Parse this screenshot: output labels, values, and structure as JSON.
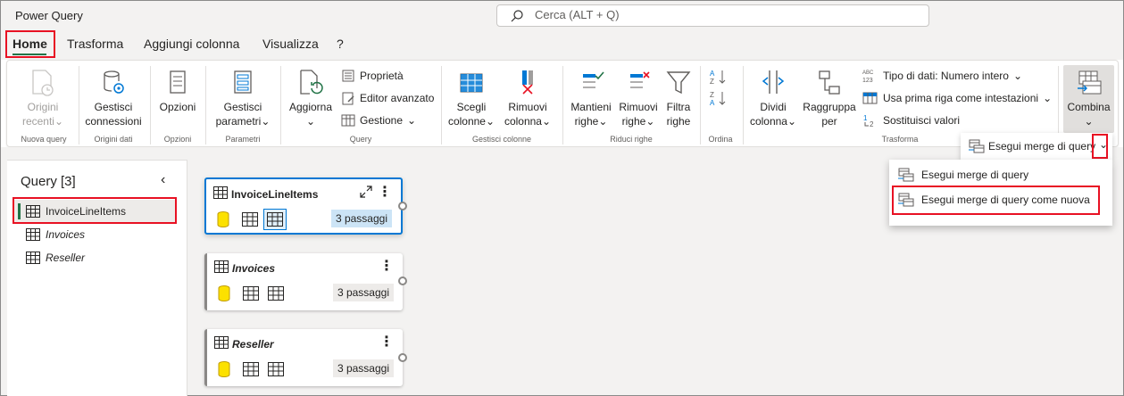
{
  "app": {
    "title": "Power Query"
  },
  "search": {
    "placeholder": "Cerca (ALT + Q)"
  },
  "tabs": [
    {
      "label": "Home",
      "active": true
    },
    {
      "label": "Trasforma"
    },
    {
      "label": "Aggiungi colonna"
    },
    {
      "label": "Visualizza"
    },
    {
      "label": "?"
    }
  ],
  "ribbon": {
    "groups": {
      "nuova_query": "Nuova query",
      "origini_dati": "Origini dati",
      "opzioni": "Opzioni",
      "parametri": "Parametri",
      "query": "Query",
      "gestisci_colonne": "Gestisci colonne",
      "riduci_righe": "Riduci righe",
      "ordina": "Ordina",
      "trasforma": "Trasforma"
    },
    "buttons": {
      "origini_recenti": [
        "Origini",
        "recenti"
      ],
      "gestisci_connessioni": [
        "Gestisci",
        "connessioni"
      ],
      "opzioni": "Opzioni",
      "gestisci_parametri": [
        "Gestisci",
        "parametri"
      ],
      "aggiorna": "Aggiorna",
      "proprieta": "Proprietà",
      "editor_avanzato": "Editor avanzato",
      "gestione": "Gestione",
      "scegli_colonne": [
        "Scegli",
        "colonne"
      ],
      "rimuovi_colonne": [
        "Rimuovi",
        "colonna"
      ],
      "mantieni_righe": [
        "Mantieni",
        "righe"
      ],
      "rimuovi_righe": [
        "Rimuovi",
        "righe"
      ],
      "filtra_righe": [
        "Filtra",
        "righe"
      ],
      "dividi_colonna": [
        "Dividi",
        "colonna"
      ],
      "raggruppa_per": [
        "Raggruppa",
        "per"
      ],
      "tipo_dati": "Tipo di dati: Numero intero",
      "prima_riga": "Usa prima riga come intestazioni",
      "sostituisci_valori": "Sostituisci valori",
      "combina": "Combina"
    }
  },
  "query_panel": {
    "title": "Query [3]",
    "items": [
      {
        "name": "InvoiceLineItems",
        "selected": true
      },
      {
        "name": "Invoices"
      },
      {
        "name": "Reseller"
      }
    ]
  },
  "diagram": {
    "cards": [
      {
        "name": "InvoiceLineItems",
        "steps": "3 passaggi",
        "selected": true
      },
      {
        "name": "Invoices",
        "steps": "3 passaggi"
      },
      {
        "name": "Reseller",
        "steps": "3 passaggi"
      }
    ]
  },
  "merge_menu": {
    "split_button": "Esegui merge di query",
    "items": [
      {
        "label": "Esegui merge di query"
      },
      {
        "label": "Esegui merge di query come nuova",
        "highlighted": true
      }
    ]
  },
  "colors": {
    "accent": "#217346",
    "highlight": "#e81123",
    "selection": "#0078d4"
  }
}
